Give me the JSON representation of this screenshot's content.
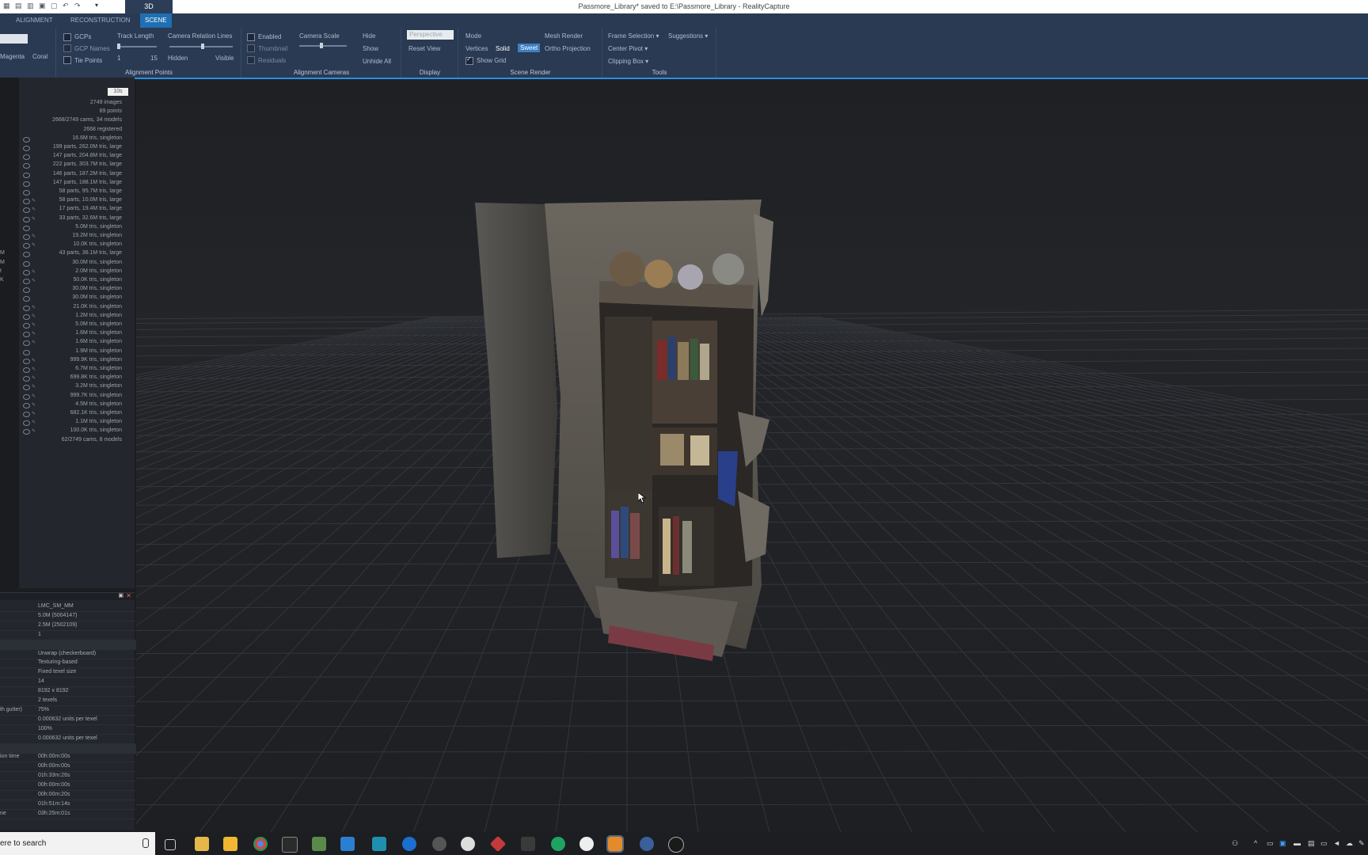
{
  "window": {
    "title": "Passmore_Library* saved to E:\\Passmore_Library - RealityCapture",
    "view_tab": "3D"
  },
  "ribbon_tabs": [
    "ALIGNMENT",
    "RECONSTRUCTION",
    "SCENE"
  ],
  "ribbon": {
    "colors": {
      "left_value": "Magenta",
      "right_value": "Coral"
    },
    "alignment_points": {
      "title": "Alignment Points",
      "gcps": "GCPs",
      "gcp_names": "GCP Names",
      "tie_points": "Tie Points",
      "track_length": "Track Length",
      "track_min": "1",
      "track_max": "15",
      "camera_relation_lines": "Camera Relation Lines",
      "hidden": "Hidden",
      "visible": "Visible"
    },
    "alignment_cameras": {
      "title": "Alignment Cameras",
      "enabled": "Enabled",
      "thumbnail": "Thumbnail",
      "residuals": "Residuals",
      "camera_scale": "Camera Scale",
      "hide": "Hide",
      "show": "Show",
      "unhide_all": "Unhide All"
    },
    "display": {
      "title": "Display",
      "projection": "Perspective",
      "reset_view": "Reset View"
    },
    "scene_render": {
      "title": "Scene Render",
      "mode": "Mode",
      "mesh_render": "Mesh Render",
      "vertices": "Vertices",
      "solid": "Solid",
      "sweet": "Sweet",
      "ortho_projection": "Ortho Projection",
      "show_grid": "Show Grid"
    },
    "tools": {
      "title": "Tools",
      "frame_selection": "Frame Selection",
      "suggestions": "Suggestions",
      "center_pivot": "Center Pivot",
      "clipping_box": "Clipping Box"
    }
  },
  "left_panel": {
    "search_value": "10s",
    "rows": [
      "2749 images",
      "89 points",
      "2668/2749 cams, 34 models",
      "2668 registered",
      "16.6M tris, singleton",
      "199 parts, 262.0M tris, large",
      "147 parts, 204.8M tris, large",
      "222 parts, 303.7M tris, large",
      "146 parts, 187.2M tris, large",
      "147 parts, 188.1M tris, large",
      "58 parts, 95.7M tris, large",
      "58 parts, 10.0M tris, large",
      "17 parts, 19.4M tris, large",
      "33 parts, 32.6M tris, large",
      "5.0M tris, singleton",
      "19.2M tris, singleton",
      "10.0K tris, singleton",
      "43 parts, 38.1M tris, large",
      "30.0M tris, singleton",
      "2.0M tris, singleton",
      "50.0K tris, singleton",
      "30.0M tris, singleton",
      "30.0M tris, singleton",
      "21.0K tris, singleton",
      "1.2M tris, singleton",
      "5.0M tris, singleton",
      "1.6M tris, singleton",
      "1.6M tris, singleton",
      "1.9M tris, singleton",
      "999.9K tris, singleton",
      "6.7M tris, singleton",
      "699.8K tris, singleton",
      "3.2M tris, singleton",
      "999.7K tris, singleton",
      "4.5M tris, singleton",
      "682.1K tris, singleton",
      "1.1M tris, singleton",
      "100.0K tris, singleton",
      "62/2749 cams, 8 models"
    ],
    "side_labels": [
      "M",
      "M",
      "t",
      "K"
    ]
  },
  "properties": {
    "rows": [
      {
        "k": "",
        "v": "LMC_SM_MM"
      },
      {
        "k": "",
        "v": "5.0M (5004147)"
      },
      {
        "k": "",
        "v": "2.5M (2502109)"
      },
      {
        "k": "",
        "v": "1"
      },
      {
        "k": "",
        "v": ""
      },
      {
        "k": "",
        "v": "Unwrap (checkerboard)"
      },
      {
        "k": "",
        "v": "Texturing-based"
      },
      {
        "k": "",
        "v": "Fixed texel size"
      },
      {
        "k": "",
        "v": "14"
      },
      {
        "k": "",
        "v": "8192 x 8192"
      },
      {
        "k": "",
        "v": "2 texels"
      },
      {
        "k": "th gutter)",
        "v": "75%"
      },
      {
        "k": "",
        "v": "0.000632 units per texel"
      },
      {
        "k": "",
        "v": "100%"
      },
      {
        "k": "",
        "v": "0.000632 units per texel"
      },
      {
        "k": "",
        "v": ""
      },
      {
        "k": "ion time",
        "v": "00h:00m:00s"
      },
      {
        "k": "",
        "v": "00h:00m:00s"
      },
      {
        "k": "",
        "v": "01h:33m:26s"
      },
      {
        "k": "",
        "v": "00h:00m:00s"
      },
      {
        "k": "",
        "v": "00h:00m:20s"
      },
      {
        "k": "",
        "v": "01h:51m:14s"
      },
      {
        "k": "ne",
        "v": "03h:25m:01s"
      }
    ]
  },
  "taskbar": {
    "search_text": "ere to search"
  },
  "colors": {
    "ribbon_bg": "#2a3a52",
    "accent": "#2b8fe5",
    "viewport_bg": "#1e2024",
    "grid": "#3a3d43"
  }
}
